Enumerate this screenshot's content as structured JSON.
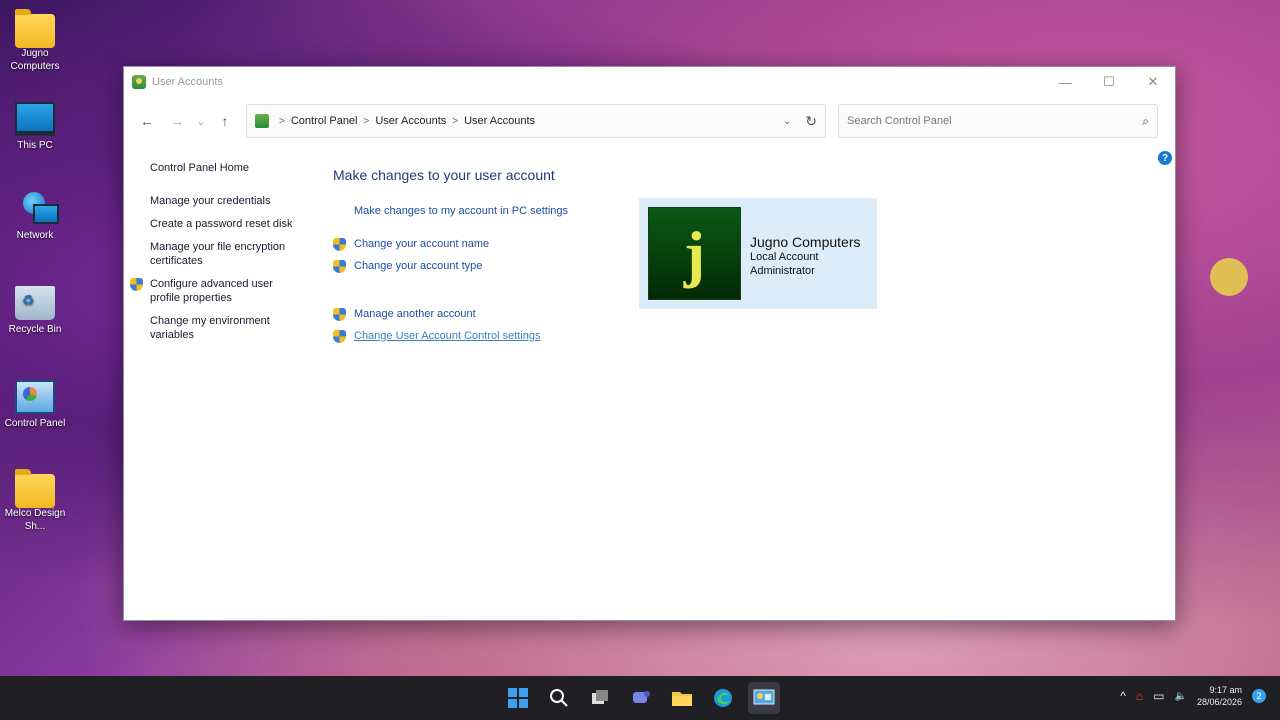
{
  "desktop": {
    "icons": [
      {
        "label": "Jugno Computers",
        "icon": "folder-icon"
      },
      {
        "label": "This PC",
        "icon": "this-pc-icon"
      },
      {
        "label": "Network",
        "icon": "network-icon"
      },
      {
        "label": "Recycle Bin",
        "icon": "recycle-bin-icon"
      },
      {
        "label": "Control Panel",
        "icon": "control-panel-icon"
      },
      {
        "label": "Melco Design Sh...",
        "icon": "folder-icon"
      }
    ]
  },
  "window": {
    "title": "User Accounts",
    "controls": {
      "minimize": "—",
      "maximize": "☐",
      "close": "✕"
    }
  },
  "nav": {
    "back": "←",
    "forward": "→",
    "recent": "⌄",
    "up": "↑",
    "breadcrumb": [
      "Control Panel",
      "User Accounts",
      "User Accounts"
    ],
    "breadcrumb_sep": ">",
    "dropdown": "⌄",
    "refresh": "↻"
  },
  "search": {
    "placeholder": "Search Control Panel",
    "icon": "⌕"
  },
  "help": "?",
  "sidebar": {
    "home": "Control Panel Home",
    "items": [
      "Manage your credentials",
      "Create a password reset disk",
      "Manage your file encryption certificates",
      "Configure advanced user profile properties",
      "Change my environment variables"
    ]
  },
  "main": {
    "heading": "Make changes to your user account",
    "pc_settings_link": "Make changes to my account in PC settings",
    "links": [
      "Change your account name",
      "Change your account type",
      "Manage another account",
      "Change User Account Control settings"
    ]
  },
  "account": {
    "avatar_letter": "j",
    "name": "Jugno Computers",
    "type": "Local Account",
    "role": "Administrator"
  },
  "taskbar": {
    "tray_chevron": "^",
    "tray_icons": [
      "⌂",
      "▭",
      "🔈"
    ],
    "time": "9:17 am",
    "date": "28/06/2026",
    "notifications": "2"
  },
  "colors": {
    "accent": "#1b4fa0",
    "heading": "#1e3c78",
    "card": "#dcecf8",
    "taskbar": "#1f1f24"
  }
}
